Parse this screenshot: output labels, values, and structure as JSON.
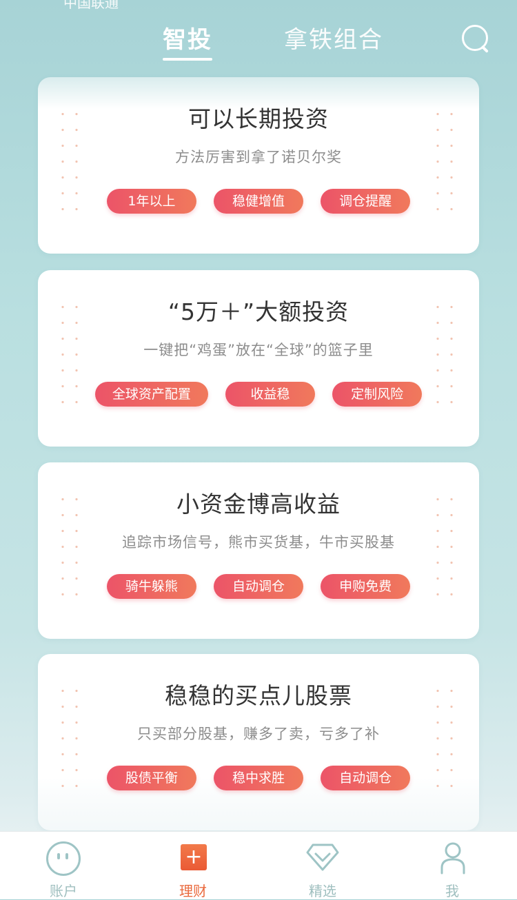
{
  "status": {
    "text": "中国联通"
  },
  "header": {
    "tabs": [
      {
        "label": "智投"
      },
      {
        "label": "拿铁组合"
      }
    ]
  },
  "cards": [
    {
      "title": "可以长期投资",
      "subtitle": "方法厉害到拿了诺贝尔奖",
      "tags": [
        "1年以上",
        "稳健增值",
        "调仓提醒"
      ]
    },
    {
      "title": "“5万＋”大额投资",
      "subtitle": "一键把“鸡蛋”放在“全球”的篮子里",
      "tags": [
        "全球资产配置",
        "收益稳",
        "定制风险"
      ]
    },
    {
      "title": "小资金博高收益",
      "subtitle": "追踪市场信号，熊市买货基，牛市买股基",
      "tags": [
        "骑牛躲熊",
        "自动调仓",
        "申购免费"
      ]
    },
    {
      "title": "稳稳的买点儿股票",
      "subtitle": "只买部分股基，赚多了卖，亏多了补",
      "tags": [
        "股债平衡",
        "稳中求胜",
        "自动调仓"
      ]
    }
  ],
  "bottom_nav": [
    {
      "label": "账户",
      "icon": "account-icon"
    },
    {
      "label": "理财",
      "icon": "plus-icon",
      "active": true
    },
    {
      "label": "精选",
      "icon": "gem-icon"
    },
    {
      "label": "我",
      "icon": "user-icon"
    }
  ],
  "colors": {
    "accent": "#ec5468",
    "accent_end": "#f0795c",
    "nav_active": "#ea6a3e",
    "nav_inactive": "#9fbfbf"
  }
}
